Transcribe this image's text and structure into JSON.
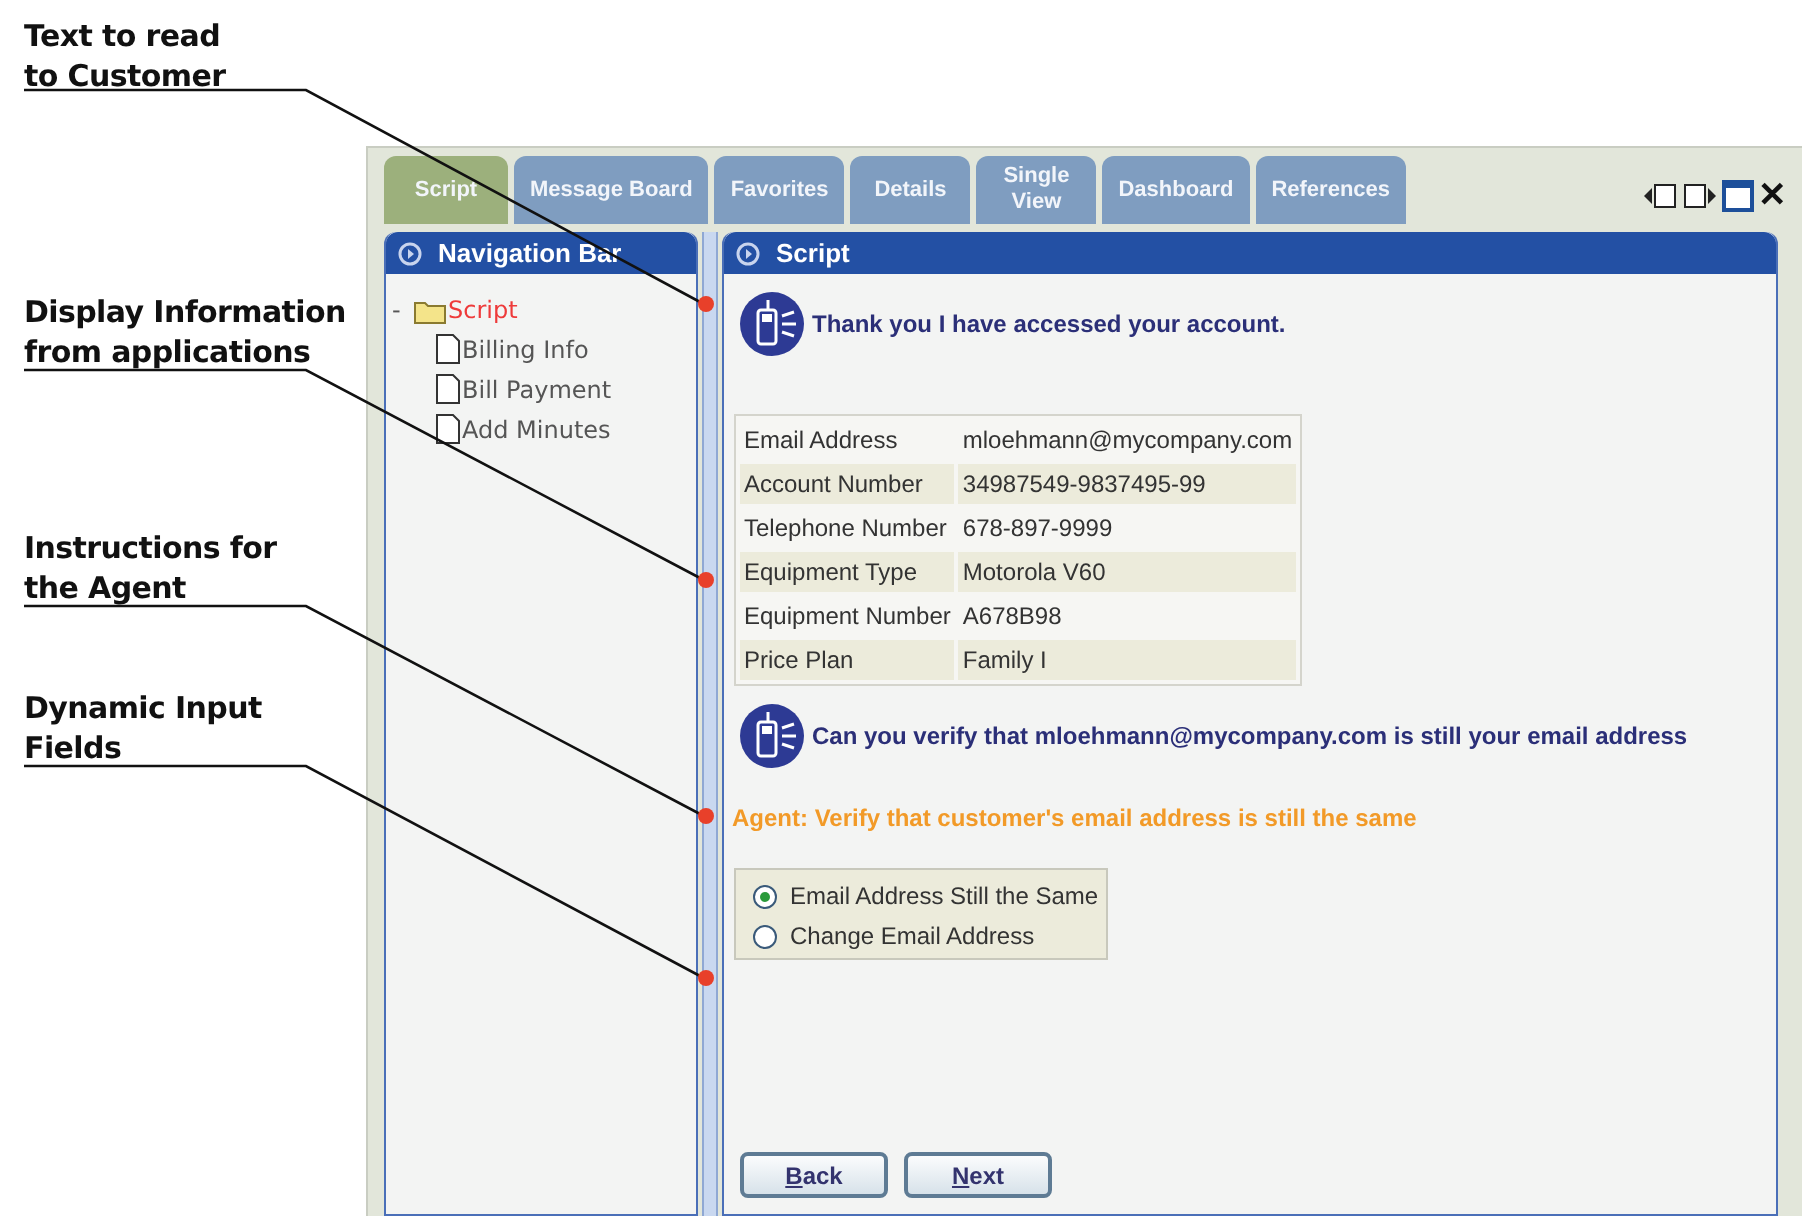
{
  "callouts": [
    {
      "lines": [
        "Text to read",
        "to Customer"
      ]
    },
    {
      "lines": [
        "Display Information",
        "from applications"
      ]
    },
    {
      "lines": [
        "Instructions for",
        "the Agent"
      ]
    },
    {
      "lines": [
        "Dynamic Input",
        "Fields"
      ]
    }
  ],
  "tabs": [
    {
      "label": "Script",
      "selected": true
    },
    {
      "label": "Message Board",
      "selected": false
    },
    {
      "label": "Favorites",
      "selected": false
    },
    {
      "label": "Details",
      "selected": false
    },
    {
      "label": "Single View",
      "selected": false
    },
    {
      "label": "Dashboard",
      "selected": false
    },
    {
      "label": "References",
      "selected": false
    }
  ],
  "window_controls": {
    "close": "✕"
  },
  "navigation": {
    "title": "Navigation Bar",
    "tree": [
      {
        "label": "Script",
        "toggle": "-",
        "selected": true,
        "children": [
          {
            "label": "Billing Info",
            "selected": false
          },
          {
            "label": "Bill Payment",
            "selected": false
          },
          {
            "label": "Add Minutes",
            "selected": false
          }
        ]
      }
    ]
  },
  "script": {
    "title": "Script",
    "sections": [
      {
        "kind": "message",
        "text": "Thank you I have accessed your account."
      },
      {
        "kind": "table",
        "rows": [
          [
            "Email Address",
            "mloehmann@mycompany.com"
          ],
          [
            "Account Number",
            "34987549-9837495-99"
          ],
          [
            "Telephone Number",
            "678-897-9999"
          ],
          [
            "Equipment Type",
            "Motorola V60"
          ],
          [
            "Equipment Number",
            "A678B98"
          ],
          [
            "Price Plan",
            "Family I"
          ]
        ]
      },
      {
        "kind": "message",
        "text": "Can you verify that mloehmann@mycompany.com is still your email address"
      },
      {
        "kind": "instruction",
        "text": "Agent: Verify that customer's email address is still the same"
      },
      {
        "kind": "radio_group",
        "options": [
          {
            "label": "Email Address Still the Same",
            "selected": true
          },
          {
            "label": "Change Email Address",
            "selected": false
          }
        ]
      }
    ],
    "buttons": [
      "Back",
      "Next"
    ]
  }
}
